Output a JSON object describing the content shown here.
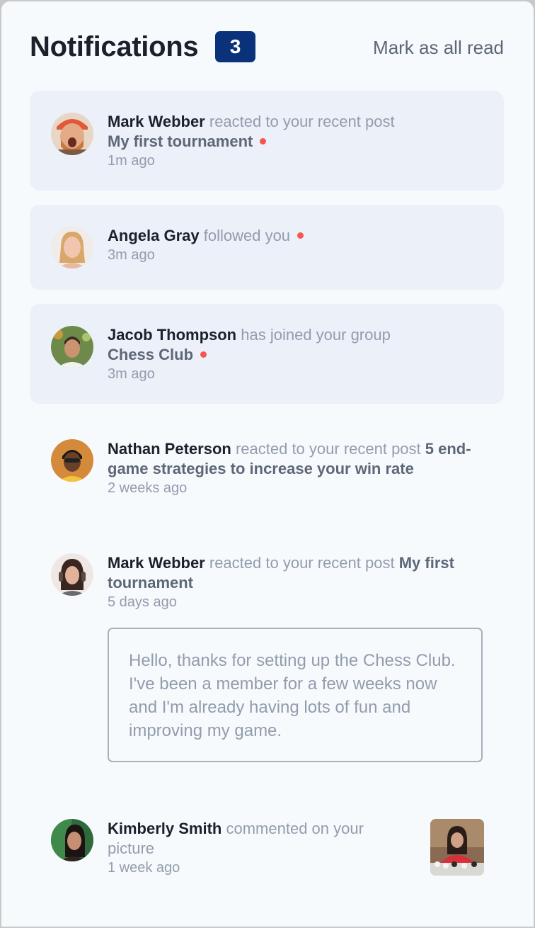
{
  "header": {
    "title": "Notifications",
    "unread_count": "3",
    "mark_all_read": "Mark as all read"
  },
  "notifications": [
    {
      "name": "Mark Webber",
      "action": "reacted to your recent post",
      "target": "My first tournament",
      "time": "1m ago",
      "unread": true,
      "avatar": "avatar-mark-webber"
    },
    {
      "name": "Angela Gray",
      "action": "followed you",
      "target": "",
      "time": "3m ago",
      "unread": true,
      "avatar": "avatar-angela-gray"
    },
    {
      "name": "Jacob Thompson",
      "action": "has joined your group",
      "target": "Chess Club",
      "time": "3m ago",
      "unread": true,
      "avatar": "avatar-jacob-thompson"
    },
    {
      "name": "Nathan Peterson",
      "action": "reacted to your recent post",
      "target": "5 end-game strategies to increase your win rate",
      "time": "2 weeks ago",
      "unread": false,
      "avatar": "avatar-nathan-peterson"
    },
    {
      "name": "Mark Webber",
      "action": "reacted to your recent post",
      "target": "My first tournament",
      "time": "5 days ago",
      "unread": false,
      "avatar": "avatar-woman-headphones",
      "message": "Hello, thanks for setting up the Chess Club. I've been a member for a few weeks now and I'm already having lots of fun and improving my game."
    },
    {
      "name": "Kimberly Smith",
      "action": "commented on your picture",
      "target": "",
      "time": "1 week ago",
      "unread": false,
      "avatar": "avatar-kimberly-smith",
      "picture": "chess-photo-thumbnail"
    }
  ],
  "colors": {
    "page_bg": "#f7fafd",
    "unread_bg": "#ebf0f9",
    "badge_bg": "#0a327b",
    "dot": "#f65552",
    "name_text": "#1c202b",
    "muted_text": "#939cad",
    "target_text": "#5e6778"
  }
}
